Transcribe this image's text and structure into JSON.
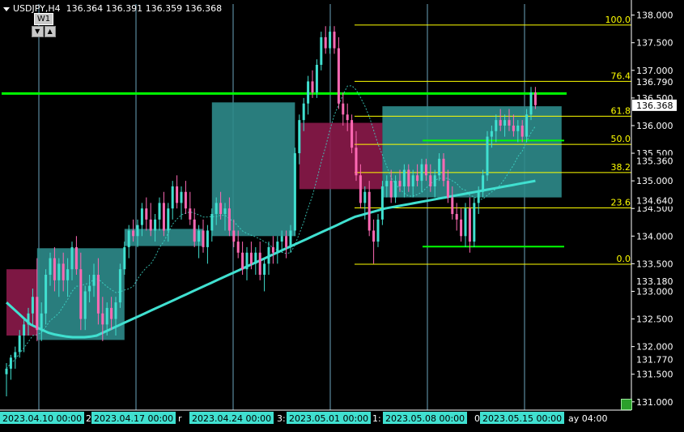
{
  "header": {
    "symbol": "USDJPY,H4",
    "ohlc": "136.364 136.391 136.359 136.368"
  },
  "timeframe_widget": {
    "label": "W1",
    "down": "▼",
    "up": "▲"
  },
  "colors": {
    "background": "#000000",
    "bull_candle": "#40E0D0",
    "bear_candle": "#FF69B4",
    "ma_line": "#40E0D0",
    "fib_line": "#FFFF00",
    "hline": "#00FF00",
    "demand_zone": "#2E8B8B",
    "supply_zone": "#8B1A4A",
    "vertical_grid": "#87CEEB"
  },
  "chart_data": {
    "type": "line",
    "title": "USDJPY,H4",
    "y_axis": {
      "ylim": [
        130.85,
        138.2
      ],
      "tick_labels": [
        "138.000",
        "137.500",
        "137.000",
        "136.500",
        "136.000",
        "135.500",
        "135.000",
        "134.500",
        "134.000",
        "133.500",
        "133.000",
        "132.500",
        "132.000",
        "131.500",
        "131.000"
      ],
      "tick_values": [
        138.0,
        137.5,
        137.0,
        136.5,
        136.0,
        135.5,
        135.0,
        134.5,
        134.0,
        133.5,
        133.0,
        132.5,
        132.0,
        131.5,
        131.0
      ],
      "price_markers": [
        {
          "label": "136.790",
          "value": 136.79
        },
        {
          "label": "136.368",
          "value": 136.368,
          "highlight": true
        },
        {
          "label": "135.360",
          "value": 135.36
        },
        {
          "label": "134.640",
          "value": 134.64
        },
        {
          "label": "133.180",
          "value": 133.18
        },
        {
          "label": "131.770",
          "value": 131.77
        }
      ]
    },
    "x_axis": {
      "tick_labels": [
        {
          "label": "2023.04.10 00:00",
          "highlight": true
        },
        {
          "label": "2023.04.17 00:00",
          "highlight": true
        },
        {
          "label": "2023.04.24 00:00",
          "highlight": true
        },
        {
          "label": "2023.05.01 00:00",
          "highlight": true
        },
        {
          "label": "2023.05.08 00:00",
          "highlight": true
        },
        {
          "label": "2023.05.15 00:00",
          "highlight": true
        },
        {
          "label": "2",
          "highlight": false
        },
        {
          "label": "r",
          "highlight": false
        },
        {
          "label": "3:",
          "highlight": false
        },
        {
          "label": "1:",
          "highlight": false
        },
        {
          "label": "0",
          "highlight": false
        },
        {
          "label": "ay 04:00",
          "highlight": false
        }
      ]
    },
    "fibonacci": {
      "levels": [
        {
          "label": "100.0",
          "value": 137.82
        },
        {
          "label": "76.4",
          "value": 136.8
        },
        {
          "label": "61.8",
          "value": 136.17
        },
        {
          "label": "50.0",
          "value": 135.66
        },
        {
          "label": "38.2",
          "value": 135.15
        },
        {
          "label": "23.6",
          "value": 134.51
        },
        {
          "label": "0.0",
          "value": 133.49
        }
      ]
    },
    "horizontal_lines": [
      {
        "value": 136.58,
        "role": "resistance"
      },
      {
        "value": 135.73,
        "role": "support-mid"
      },
      {
        "value": 133.81,
        "role": "support-low"
      }
    ],
    "zones": [
      {
        "type": "supply",
        "x_from": 0,
        "x_to": 7,
        "y_top": 133.4,
        "y_bottom": 132.2
      },
      {
        "type": "demand",
        "x_from": 7,
        "x_to": 27,
        "y_top": 133.78,
        "y_bottom": 132.12
      },
      {
        "type": "demand",
        "x_from": 27,
        "x_to": 45,
        "y_top": 134.13,
        "y_bottom": 133.82
      },
      {
        "type": "demand",
        "x_from": 47,
        "x_to": 66,
        "y_top": 136.42,
        "y_bottom": 134.0
      },
      {
        "type": "supply",
        "x_from": 67,
        "x_to": 86,
        "y_top": 136.05,
        "y_bottom": 134.85
      },
      {
        "type": "demand",
        "x_from": 86,
        "x_to": 127,
        "y_top": 136.35,
        "y_bottom": 134.7
      }
    ],
    "candles": [
      {
        "o": 131.5,
        "h": 131.7,
        "l": 131.1,
        "c": 131.6
      },
      {
        "o": 131.6,
        "h": 131.85,
        "l": 131.4,
        "c": 131.8
      },
      {
        "o": 131.8,
        "h": 132.0,
        "l": 131.6,
        "c": 131.9
      },
      {
        "o": 131.9,
        "h": 132.3,
        "l": 131.8,
        "c": 132.2
      },
      {
        "o": 132.2,
        "h": 132.5,
        "l": 131.9,
        "c": 132.4
      },
      {
        "o": 132.4,
        "h": 132.7,
        "l": 132.2,
        "c": 132.6
      },
      {
        "o": 132.6,
        "h": 133.05,
        "l": 132.4,
        "c": 132.9
      },
      {
        "o": 132.9,
        "h": 133.6,
        "l": 132.1,
        "c": 132.3
      },
      {
        "o": 132.3,
        "h": 132.8,
        "l": 132.1,
        "c": 132.6
      },
      {
        "o": 132.6,
        "h": 133.4,
        "l": 132.4,
        "c": 133.3
      },
      {
        "o": 133.3,
        "h": 133.7,
        "l": 133.1,
        "c": 133.6
      },
      {
        "o": 133.6,
        "h": 133.8,
        "l": 133.0,
        "c": 133.2
      },
      {
        "o": 133.2,
        "h": 133.6,
        "l": 132.9,
        "c": 133.5
      },
      {
        "o": 133.5,
        "h": 133.7,
        "l": 133.0,
        "c": 133.2
      },
      {
        "o": 133.2,
        "h": 133.6,
        "l": 132.9,
        "c": 133.4
      },
      {
        "o": 133.4,
        "h": 133.9,
        "l": 133.2,
        "c": 133.8
      },
      {
        "o": 133.8,
        "h": 134.0,
        "l": 133.3,
        "c": 133.4
      },
      {
        "o": 133.4,
        "h": 133.7,
        "l": 132.3,
        "c": 132.5
      },
      {
        "o": 132.5,
        "h": 133.1,
        "l": 132.3,
        "c": 133.0
      },
      {
        "o": 133.0,
        "h": 133.3,
        "l": 132.8,
        "c": 133.1
      },
      {
        "o": 133.1,
        "h": 133.5,
        "l": 132.9,
        "c": 133.3
      },
      {
        "o": 133.3,
        "h": 133.6,
        "l": 132.4,
        "c": 132.6
      },
      {
        "o": 132.6,
        "h": 132.9,
        "l": 132.1,
        "c": 132.4
      },
      {
        "o": 132.4,
        "h": 132.8,
        "l": 132.2,
        "c": 132.7
      },
      {
        "o": 132.7,
        "h": 132.9,
        "l": 132.3,
        "c": 132.5
      },
      {
        "o": 132.5,
        "h": 132.9,
        "l": 132.2,
        "c": 132.8
      },
      {
        "o": 132.8,
        "h": 133.5,
        "l": 132.7,
        "c": 133.4
      },
      {
        "o": 133.4,
        "h": 133.9,
        "l": 133.3,
        "c": 133.8
      },
      {
        "o": 133.8,
        "h": 134.2,
        "l": 133.6,
        "c": 134.1
      },
      {
        "o": 134.1,
        "h": 134.3,
        "l": 133.9,
        "c": 134.0
      },
      {
        "o": 134.0,
        "h": 134.3,
        "l": 133.8,
        "c": 134.2
      },
      {
        "o": 134.2,
        "h": 134.6,
        "l": 134.0,
        "c": 134.5
      },
      {
        "o": 134.5,
        "h": 134.7,
        "l": 134.1,
        "c": 134.3
      },
      {
        "o": 134.3,
        "h": 134.6,
        "l": 134.0,
        "c": 134.1
      },
      {
        "o": 134.1,
        "h": 134.4,
        "l": 133.9,
        "c": 134.3
      },
      {
        "o": 134.3,
        "h": 134.7,
        "l": 134.1,
        "c": 134.6
      },
      {
        "o": 134.6,
        "h": 134.8,
        "l": 134.0,
        "c": 134.1
      },
      {
        "o": 134.1,
        "h": 134.6,
        "l": 133.9,
        "c": 134.5
      },
      {
        "o": 134.5,
        "h": 135.0,
        "l": 134.3,
        "c": 134.9
      },
      {
        "o": 134.9,
        "h": 135.1,
        "l": 134.5,
        "c": 134.6
      },
      {
        "o": 134.6,
        "h": 134.9,
        "l": 134.3,
        "c": 134.8
      },
      {
        "o": 134.8,
        "h": 135.0,
        "l": 134.4,
        "c": 134.5
      },
      {
        "o": 134.5,
        "h": 134.8,
        "l": 134.2,
        "c": 134.3
      },
      {
        "o": 134.3,
        "h": 134.5,
        "l": 133.8,
        "c": 133.9
      },
      {
        "o": 133.9,
        "h": 134.2,
        "l": 133.6,
        "c": 134.1
      },
      {
        "o": 134.1,
        "h": 134.3,
        "l": 133.7,
        "c": 133.8
      },
      {
        "o": 133.8,
        "h": 134.2,
        "l": 133.5,
        "c": 134.1
      },
      {
        "o": 134.1,
        "h": 134.5,
        "l": 133.9,
        "c": 134.4
      },
      {
        "o": 134.4,
        "h": 134.7,
        "l": 134.2,
        "c": 134.6
      },
      {
        "o": 134.6,
        "h": 134.8,
        "l": 134.3,
        "c": 134.4
      },
      {
        "o": 134.4,
        "h": 134.6,
        "l": 134.1,
        "c": 134.5
      },
      {
        "o": 134.5,
        "h": 134.7,
        "l": 134.0,
        "c": 134.1
      },
      {
        "o": 134.1,
        "h": 134.3,
        "l": 133.8,
        "c": 133.9
      },
      {
        "o": 133.9,
        "h": 134.1,
        "l": 133.6,
        "c": 133.7
      },
      {
        "o": 133.7,
        "h": 133.9,
        "l": 133.3,
        "c": 133.4
      },
      {
        "o": 133.4,
        "h": 133.8,
        "l": 133.2,
        "c": 133.7
      },
      {
        "o": 133.7,
        "h": 133.9,
        "l": 133.4,
        "c": 133.5
      },
      {
        "o": 133.5,
        "h": 133.8,
        "l": 133.3,
        "c": 133.7
      },
      {
        "o": 133.7,
        "h": 133.9,
        "l": 133.2,
        "c": 133.3
      },
      {
        "o": 133.3,
        "h": 133.6,
        "l": 133.0,
        "c": 133.5
      },
      {
        "o": 133.5,
        "h": 133.9,
        "l": 133.3,
        "c": 133.8
      },
      {
        "o": 133.8,
        "h": 134.0,
        "l": 133.5,
        "c": 133.7
      },
      {
        "o": 133.7,
        "h": 134.0,
        "l": 133.5,
        "c": 133.9
      },
      {
        "o": 133.9,
        "h": 134.1,
        "l": 133.7,
        "c": 134.0
      },
      {
        "o": 134.0,
        "h": 134.1,
        "l": 133.6,
        "c": 133.8
      },
      {
        "o": 133.8,
        "h": 134.2,
        "l": 133.7,
        "c": 134.1
      },
      {
        "o": 134.1,
        "h": 135.6,
        "l": 134.0,
        "c": 135.5
      },
      {
        "o": 135.5,
        "h": 136.2,
        "l": 135.3,
        "c": 136.1
      },
      {
        "o": 136.1,
        "h": 136.5,
        "l": 135.9,
        "c": 136.4
      },
      {
        "o": 136.4,
        "h": 136.9,
        "l": 136.2,
        "c": 136.8
      },
      {
        "o": 136.8,
        "h": 137.0,
        "l": 136.5,
        "c": 136.6
      },
      {
        "o": 136.6,
        "h": 137.2,
        "l": 136.5,
        "c": 137.1
      },
      {
        "o": 137.1,
        "h": 137.7,
        "l": 137.0,
        "c": 137.6
      },
      {
        "o": 137.6,
        "h": 137.8,
        "l": 137.3,
        "c": 137.4
      },
      {
        "o": 137.4,
        "h": 137.8,
        "l": 137.3,
        "c": 137.7
      },
      {
        "o": 137.7,
        "h": 137.8,
        "l": 137.3,
        "c": 137.4
      },
      {
        "o": 137.4,
        "h": 137.6,
        "l": 136.3,
        "c": 136.4
      },
      {
        "o": 136.4,
        "h": 136.6,
        "l": 136.0,
        "c": 136.2
      },
      {
        "o": 136.2,
        "h": 136.4,
        "l": 135.9,
        "c": 136.1
      },
      {
        "o": 136.1,
        "h": 136.2,
        "l": 135.5,
        "c": 135.6
      },
      {
        "o": 135.6,
        "h": 135.9,
        "l": 135.0,
        "c": 135.1
      },
      {
        "o": 135.1,
        "h": 135.3,
        "l": 134.5,
        "c": 134.6
      },
      {
        "o": 134.6,
        "h": 134.9,
        "l": 134.3,
        "c": 134.8
      },
      {
        "o": 134.8,
        "h": 135.0,
        "l": 134.0,
        "c": 134.1
      },
      {
        "o": 134.1,
        "h": 134.3,
        "l": 133.5,
        "c": 133.9
      },
      {
        "o": 133.9,
        "h": 134.4,
        "l": 133.8,
        "c": 134.3
      },
      {
        "o": 134.3,
        "h": 135.0,
        "l": 134.2,
        "c": 134.9
      },
      {
        "o": 134.9,
        "h": 135.1,
        "l": 134.7,
        "c": 135.0
      },
      {
        "o": 135.0,
        "h": 135.2,
        "l": 134.6,
        "c": 134.7
      },
      {
        "o": 134.7,
        "h": 135.1,
        "l": 134.6,
        "c": 135.0
      },
      {
        "o": 135.0,
        "h": 135.2,
        "l": 134.8,
        "c": 134.9
      },
      {
        "o": 134.9,
        "h": 135.3,
        "l": 134.7,
        "c": 135.2
      },
      {
        "o": 135.2,
        "h": 135.3,
        "l": 134.8,
        "c": 134.9
      },
      {
        "o": 134.9,
        "h": 135.2,
        "l": 134.7,
        "c": 135.1
      },
      {
        "o": 135.1,
        "h": 135.3,
        "l": 134.9,
        "c": 135.0
      },
      {
        "o": 135.0,
        "h": 135.4,
        "l": 134.8,
        "c": 135.3
      },
      {
        "o": 135.3,
        "h": 135.4,
        "l": 135.0,
        "c": 135.1
      },
      {
        "o": 135.1,
        "h": 135.3,
        "l": 134.8,
        "c": 134.9
      },
      {
        "o": 134.9,
        "h": 135.2,
        "l": 134.7,
        "c": 135.1
      },
      {
        "o": 135.1,
        "h": 135.5,
        "l": 135.0,
        "c": 135.4
      },
      {
        "o": 135.4,
        "h": 135.5,
        "l": 134.9,
        "c": 135.0
      },
      {
        "o": 135.0,
        "h": 135.2,
        "l": 134.6,
        "c": 134.7
      },
      {
        "o": 134.7,
        "h": 134.9,
        "l": 134.3,
        "c": 134.4
      },
      {
        "o": 134.4,
        "h": 134.6,
        "l": 134.1,
        "c": 134.3
      },
      {
        "o": 134.3,
        "h": 134.5,
        "l": 133.9,
        "c": 134.0
      },
      {
        "o": 134.0,
        "h": 134.6,
        "l": 133.8,
        "c": 134.5
      },
      {
        "o": 134.5,
        "h": 134.7,
        "l": 133.7,
        "c": 133.9
      },
      {
        "o": 133.9,
        "h": 134.7,
        "l": 133.8,
        "c": 134.6
      },
      {
        "o": 134.6,
        "h": 134.9,
        "l": 134.4,
        "c": 134.8
      },
      {
        "o": 134.8,
        "h": 135.2,
        "l": 134.7,
        "c": 135.1
      },
      {
        "o": 135.1,
        "h": 135.9,
        "l": 135.0,
        "c": 135.8
      },
      {
        "o": 135.8,
        "h": 136.0,
        "l": 135.6,
        "c": 135.9
      },
      {
        "o": 135.9,
        "h": 136.2,
        "l": 135.7,
        "c": 136.1
      },
      {
        "o": 136.1,
        "h": 136.3,
        "l": 135.9,
        "c": 136.0
      },
      {
        "o": 136.0,
        "h": 136.2,
        "l": 135.8,
        "c": 136.1
      },
      {
        "o": 136.1,
        "h": 136.3,
        "l": 135.9,
        "c": 136.0
      },
      {
        "o": 136.0,
        "h": 136.2,
        "l": 135.8,
        "c": 135.9
      },
      {
        "o": 135.9,
        "h": 136.1,
        "l": 135.7,
        "c": 136.0
      },
      {
        "o": 136.0,
        "h": 136.1,
        "l": 135.7,
        "c": 135.8
      },
      {
        "o": 135.8,
        "h": 136.3,
        "l": 135.7,
        "c": 136.2
      },
      {
        "o": 136.2,
        "h": 136.7,
        "l": 136.1,
        "c": 136.6
      },
      {
        "o": 136.6,
        "h": 136.7,
        "l": 136.3,
        "c": 136.37
      }
    ],
    "moving_average_slow": [
      132.8,
      132.7,
      132.6,
      132.5,
      132.4,
      132.35,
      132.3,
      132.25,
      132.22,
      132.2,
      132.18,
      132.17,
      132.17,
      132.17,
      132.18,
      132.2,
      132.25,
      132.3,
      132.35,
      132.4,
      132.45,
      132.5,
      132.55,
      132.6,
      132.65,
      132.7,
      132.75,
      132.8,
      132.85,
      132.9,
      132.95,
      133.0,
      133.05,
      133.1,
      133.15,
      133.2,
      133.25,
      133.3,
      133.35,
      133.4,
      133.45,
      133.5,
      133.55,
      133.6,
      133.65,
      133.7,
      133.75,
      133.8,
      133.85,
      133.9,
      133.95,
      134.0,
      134.05,
      134.1,
      134.15,
      134.2,
      134.25,
      134.3,
      134.35,
      134.38,
      134.41,
      134.44,
      134.47,
      134.5,
      134.52,
      134.54,
      134.56,
      134.58,
      134.6,
      134.62,
      134.64,
      134.66,
      134.68,
      134.7,
      134.72,
      134.74,
      134.76,
      134.78,
      134.8,
      134.82,
      134.84,
      134.86,
      134.88,
      134.9,
      134.92,
      134.94,
      134.96,
      134.98,
      135.0
    ]
  }
}
